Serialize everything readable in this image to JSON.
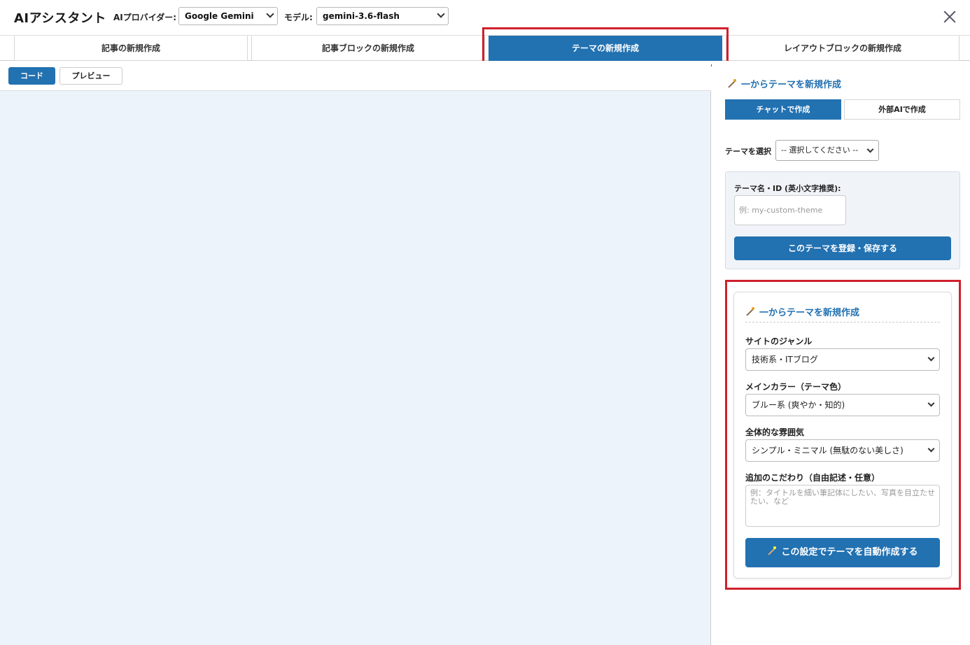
{
  "header": {
    "title": "AIアシスタント",
    "provider_label": "AIプロバイダー:",
    "provider_value": "Google Gemini",
    "model_label": "モデル:",
    "model_value": "gemini-3.6-flash"
  },
  "tabs": [
    {
      "label": "記事の新規作成"
    },
    {
      "label": "記事ブロックの新規作成"
    },
    {
      "label": "テーマの新規作成"
    },
    {
      "label": "レイアウトブロックの新規作成"
    }
  ],
  "active_tab": "テーマの新規作成",
  "editor_toolbar": {
    "code_label": "コード",
    "preview_label": "プレビュー"
  },
  "sidebar": {
    "section_title": "一からテーマを新規作成",
    "subtabs": [
      "チャットで作成",
      "外部AIで作成"
    ],
    "theme_select_label": "テーマを選択",
    "theme_select_value": "-- 選択してください --",
    "theme_name_label": "テーマ名・ID (英小文字推奨):",
    "theme_name_placeholder": "例: my-custom-theme",
    "register_button": "このテーマを登録・保存する",
    "card": {
      "title": "一からテーマを新規作成",
      "genre_label": "サイトのジャンル",
      "genre_value": "技術系・ITブログ",
      "color_label": "メインカラー（テーマ色）",
      "color_value": "ブルー系 (爽やか・知的)",
      "mood_label": "全体的な雰囲気",
      "mood_value": "シンプル・ミニマル (無駄のない美しさ)",
      "extra_label": "追加のこだわり（自由記述・任意）",
      "extra_placeholder": "例：タイトルを細い筆記体にしたい、写真を目立たせたい、など",
      "generate_button": "この設定でテーマを自動作成する"
    }
  },
  "colors": {
    "accent": "#2271b1",
    "highlight_frame": "#d0202c",
    "editor_bg": "#edf3fa"
  }
}
